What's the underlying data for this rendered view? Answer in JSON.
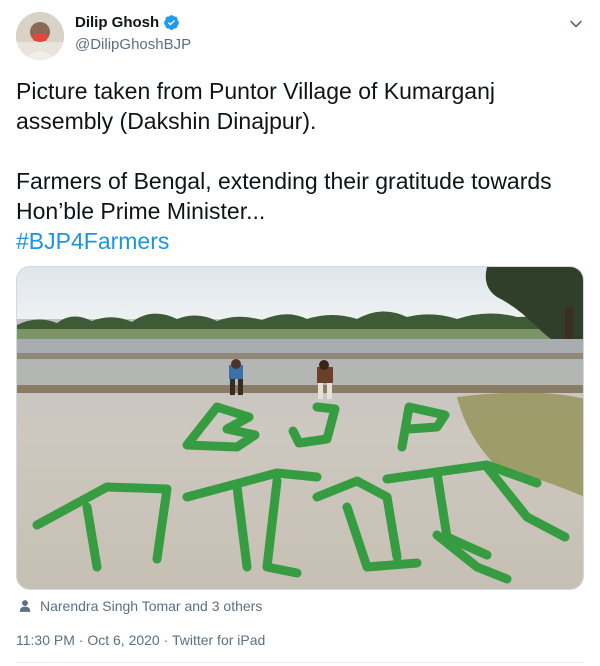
{
  "author": {
    "display_name": "Dilip Ghosh",
    "handle": "@DilipGhoshBJP",
    "verified": true
  },
  "tweet": {
    "line1": "Picture taken from Puntor Village of Kumarganj",
    "line2": "assembly (Dakshin Dinajpur).",
    "line3": "Farmers of Bengal, extending their gratitude towards",
    "line4": "Hon’ble Prime Minister...",
    "hashtag": "#BJP4Farmers"
  },
  "media": {
    "image_text_top": "BJP",
    "image_text_bottom": "भाजपा"
  },
  "tagged": {
    "text": "Narendra Singh Tomar and 3 others"
  },
  "meta": {
    "time": "11:30 PM",
    "date": "Oct 6, 2020",
    "source": "Twitter for iPad",
    "sep": "·"
  },
  "colors": {
    "accent": "#1b95e0",
    "secondary_text": "#5b7083",
    "primary_text": "#0f1419"
  },
  "icons": [
    "verified-badge-icon",
    "chevron-down-icon",
    "person-icon"
  ]
}
